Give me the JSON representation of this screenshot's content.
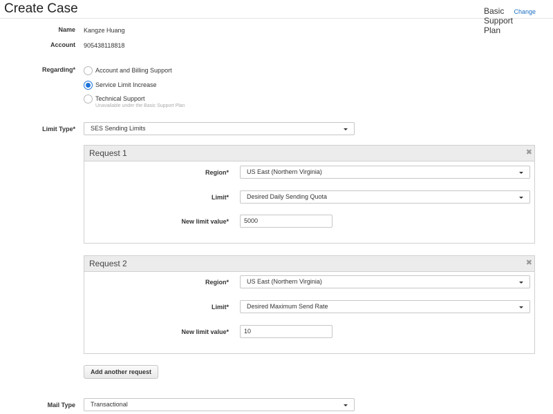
{
  "header": {
    "title": "Create Case",
    "plan": "Basic Support Plan",
    "change_link": "Change"
  },
  "fields": {
    "name_label": "Name",
    "name_value": "Kangze Huang",
    "account_label": "Account",
    "account_value": "905438118818",
    "regarding_label": "Regarding*",
    "limit_type_label": "Limit Type*",
    "limit_type_value": "SES Sending Limits",
    "mail_type_label": "Mail Type",
    "mail_type_value": "Transactional"
  },
  "regarding_options": [
    {
      "label": "Account and Billing Support",
      "selected": false
    },
    {
      "label": "Service Limit Increase",
      "selected": true
    },
    {
      "label": "Technical Support",
      "sublabel": "Unavailable under the Basic Support Plan",
      "selected": false
    }
  ],
  "requests": [
    {
      "title": "Request 1",
      "region_label": "Region*",
      "region_value": "US East (Northern Virginia)",
      "limit_label": "Limit*",
      "limit_value": "Desired Daily Sending Quota",
      "new_limit_label": "New limit value*",
      "new_limit_value": "5000"
    },
    {
      "title": "Request 2",
      "region_label": "Region*",
      "region_value": "US East (Northern Virginia)",
      "limit_label": "Limit*",
      "limit_value": "Desired Maximum Send Rate",
      "new_limit_label": "New limit value*",
      "new_limit_value": "10"
    }
  ],
  "add_request_label": "Add another request",
  "close_glyph": "✖",
  "colors": {
    "link": "#1a6ec2",
    "radio_selected": "#1a73d9",
    "panel_header": "#ececec"
  }
}
